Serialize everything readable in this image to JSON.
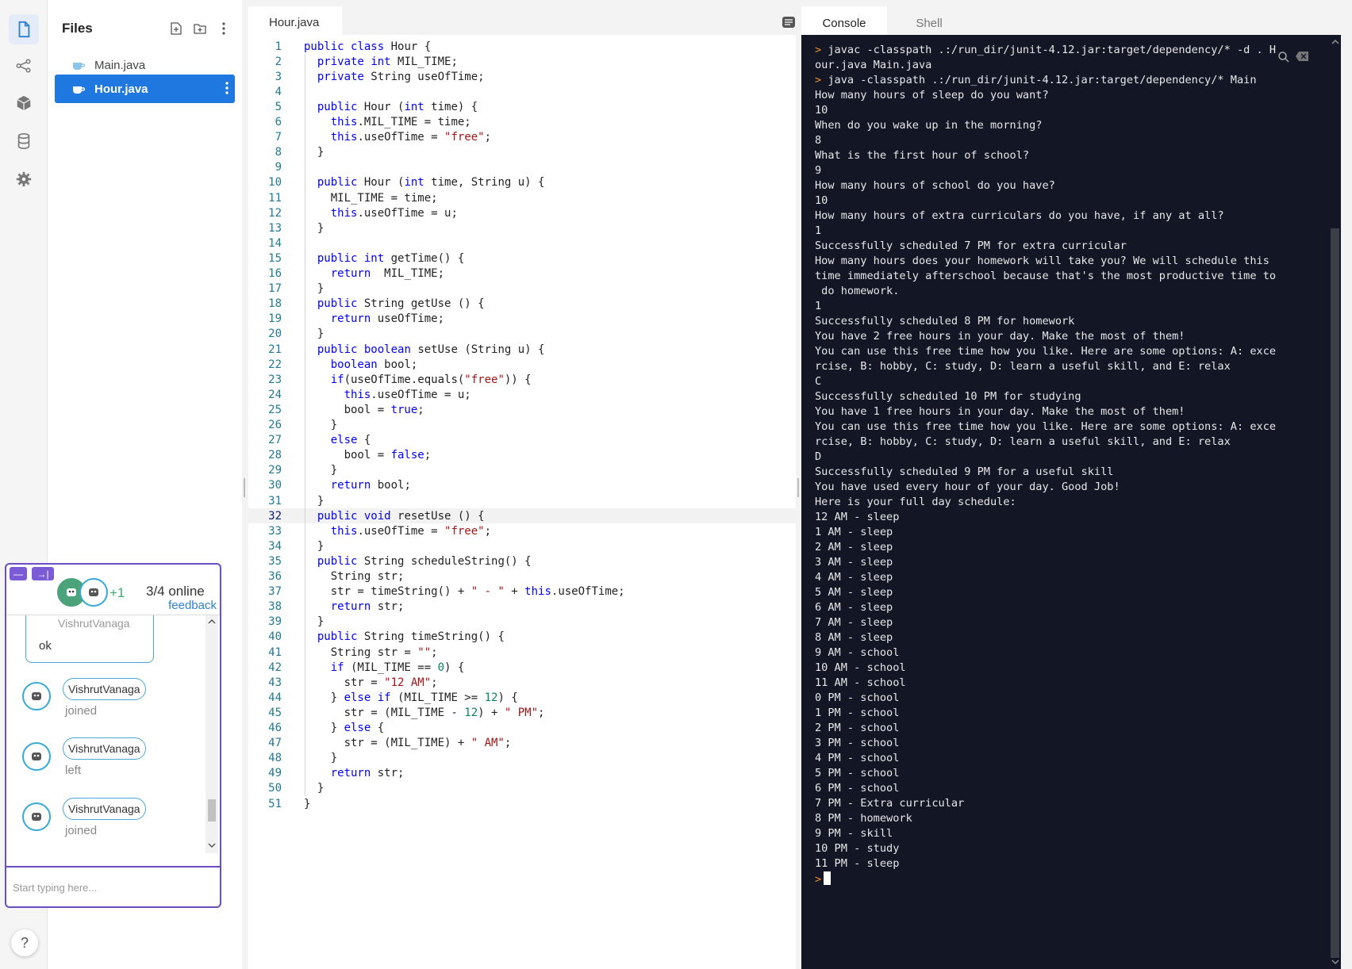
{
  "files_panel": {
    "title": "Files",
    "items": [
      {
        "name": "Main.java"
      },
      {
        "name": "Hour.java"
      }
    ]
  },
  "chat": {
    "plus_count": "+1",
    "online": "3/4 online",
    "feedback": "feedback",
    "messages": [
      {
        "user": "VishrutVanaga",
        "text": "ok"
      },
      {
        "user": "VishrutVanaga",
        "text": "joined"
      },
      {
        "user": "VishrutVanaga",
        "text": "left"
      },
      {
        "user": "VishrutVanaga",
        "text": "joined"
      }
    ],
    "input_placeholder": "Start typing here..."
  },
  "help": "?",
  "editor": {
    "tab": "Hour.java",
    "current_line": 32,
    "lines": [
      "public class Hour {",
      "  private int MIL_TIME;",
      "  private String useOfTime;",
      "",
      "  public Hour (int time) {",
      "    this.MIL_TIME = time;",
      "    this.useOfTime = \"free\";",
      "  }",
      "",
      "  public Hour (int time, String u) {",
      "    MIL_TIME = time;",
      "    this.useOfTime = u;",
      "  }",
      "",
      "  public int getTime() {",
      "    return  MIL_TIME;",
      "  }",
      "  public String getUse () {",
      "    return useOfTime;",
      "  }",
      "  public boolean setUse (String u) {",
      "    boolean bool;",
      "    if(useOfTime.equals(\"free\")) {",
      "      this.useOfTime = u;",
      "      bool = true;",
      "    }",
      "    else {",
      "      bool = false;",
      "    }",
      "    return bool;",
      "  }",
      "  public void resetUse () {",
      "    this.useOfTime = \"free\";",
      "  }",
      "  public String scheduleString() {",
      "    String str;",
      "    str = timeString() + \" - \" + this.useOfTime;",
      "    return str;",
      "  }",
      "  public String timeString() {",
      "    String str = \"\";",
      "    if (MIL_TIME == 0) {",
      "      str = \"12 AM\";",
      "    } else if (MIL_TIME >= 12) {",
      "      str = (MIL_TIME - 12) + \" PM\";",
      "    } else {",
      "      str = (MIL_TIME) + \" AM\";",
      "    }",
      "    return str;",
      "  }",
      "}"
    ]
  },
  "console": {
    "tabs": [
      {
        "label": "Console",
        "active": true
      },
      {
        "label": "Shell",
        "active": false
      }
    ],
    "lines": [
      {
        "prompt": true,
        "text": "javac -classpath .:/run_dir/junit-4.12.jar:target/dependency/* -d . H"
      },
      {
        "prompt": false,
        "text": "our.java Main.java"
      },
      {
        "prompt": true,
        "text": "java -classpath .:/run_dir/junit-4.12.jar:target/dependency/* Main"
      },
      {
        "prompt": false,
        "text": "How many hours of sleep do you want?"
      },
      {
        "prompt": false,
        "text": "10"
      },
      {
        "prompt": false,
        "text": "When do you wake up in the morning?"
      },
      {
        "prompt": false,
        "text": "8"
      },
      {
        "prompt": false,
        "text": "What is the first hour of school?"
      },
      {
        "prompt": false,
        "text": "9"
      },
      {
        "prompt": false,
        "text": "How many hours of school do you have?"
      },
      {
        "prompt": false,
        "text": "10"
      },
      {
        "prompt": false,
        "text": "How many hours of extra curriculars do you have, if any at all?"
      },
      {
        "prompt": false,
        "text": "1"
      },
      {
        "prompt": false,
        "text": "Successfully scheduled 7 PM for extra curricular"
      },
      {
        "prompt": false,
        "text": "How many hours does your homework will take you? We will schedule this"
      },
      {
        "prompt": false,
        "text": "time immediately afterschool because that's the most productive time to"
      },
      {
        "prompt": false,
        "text": " do homework."
      },
      {
        "prompt": false,
        "text": "1"
      },
      {
        "prompt": false,
        "text": "Successfully scheduled 8 PM for homework"
      },
      {
        "prompt": false,
        "text": "You have 2 free hours in your day. Make the most of them!"
      },
      {
        "prompt": false,
        "text": "You can use this free time how you like. Here are some options: A: exce"
      },
      {
        "prompt": false,
        "text": "rcise, B: hobby, C: study, D: learn a useful skill, and E: relax"
      },
      {
        "prompt": false,
        "text": "C"
      },
      {
        "prompt": false,
        "text": "Successfully scheduled 10 PM for studying"
      },
      {
        "prompt": false,
        "text": "You have 1 free hours in your day. Make the most of them!"
      },
      {
        "prompt": false,
        "text": "You can use this free time how you like. Here are some options: A: exce"
      },
      {
        "prompt": false,
        "text": "rcise, B: hobby, C: study, D: learn a useful skill, and E: relax"
      },
      {
        "prompt": false,
        "text": "D"
      },
      {
        "prompt": false,
        "text": "Successfully scheduled 9 PM for a useful skill"
      },
      {
        "prompt": false,
        "text": "You have used every hour of your day. Good Job!"
      },
      {
        "prompt": false,
        "text": "Here is your full day schedule:"
      },
      {
        "prompt": false,
        "text": "12 AM - sleep"
      },
      {
        "prompt": false,
        "text": "1 AM - sleep"
      },
      {
        "prompt": false,
        "text": "2 AM - sleep"
      },
      {
        "prompt": false,
        "text": "3 AM - sleep"
      },
      {
        "prompt": false,
        "text": "4 AM - sleep"
      },
      {
        "prompt": false,
        "text": "5 AM - sleep"
      },
      {
        "prompt": false,
        "text": "6 AM - sleep"
      },
      {
        "prompt": false,
        "text": "7 AM - sleep"
      },
      {
        "prompt": false,
        "text": "8 AM - sleep"
      },
      {
        "prompt": false,
        "text": "9 AM - school"
      },
      {
        "prompt": false,
        "text": "10 AM - school"
      },
      {
        "prompt": false,
        "text": "11 AM - school"
      },
      {
        "prompt": false,
        "text": "0 PM - school"
      },
      {
        "prompt": false,
        "text": "1 PM - school"
      },
      {
        "prompt": false,
        "text": "2 PM - school"
      },
      {
        "prompt": false,
        "text": "3 PM - school"
      },
      {
        "prompt": false,
        "text": "4 PM - school"
      },
      {
        "prompt": false,
        "text": "5 PM - school"
      },
      {
        "prompt": false,
        "text": "6 PM - school"
      },
      {
        "prompt": false,
        "text": "7 PM - Extra curricular"
      },
      {
        "prompt": false,
        "text": "8 PM - homework"
      },
      {
        "prompt": false,
        "text": "9 PM - skill"
      },
      {
        "prompt": false,
        "text": "10 PM - study"
      },
      {
        "prompt": false,
        "text": "11 PM - sleep"
      }
    ]
  },
  "colors": {
    "accent": "#1e78e0",
    "chat_border": "#6a4ec2",
    "terminal_bg": "#121625",
    "prompt": "#f08c2a"
  }
}
